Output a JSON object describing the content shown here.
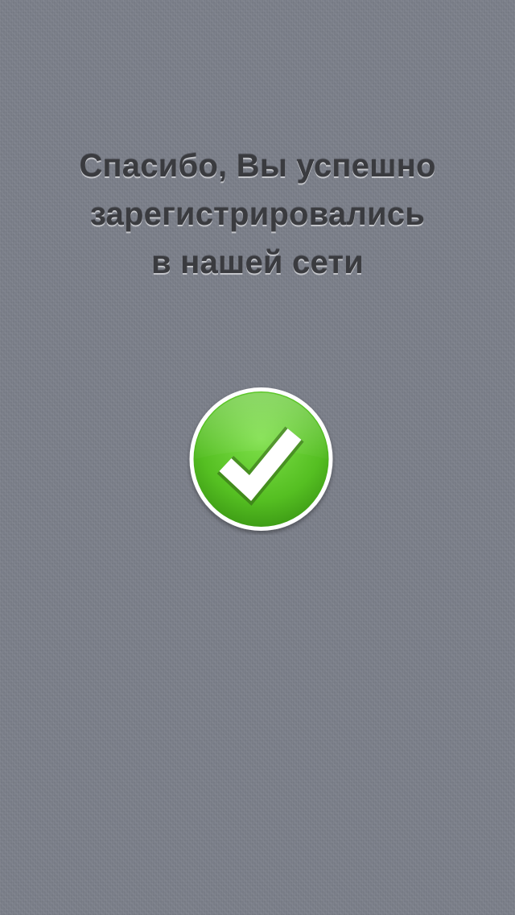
{
  "message": {
    "line1": "Спасибо, Вы успешно",
    "line2": "зарегистрировались",
    "line3": "в нашей сети"
  },
  "icon": {
    "name": "checkmark-success-icon",
    "color": "#5cc22c"
  }
}
